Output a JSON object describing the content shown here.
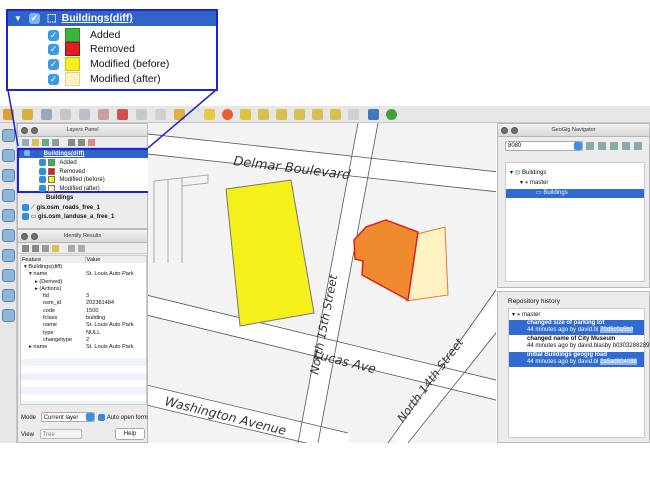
{
  "callout": {
    "layer_title": "Buildings(diff)",
    "legend": [
      {
        "label": "Added",
        "color": "#3cb43c"
      },
      {
        "label": "Removed",
        "color": "#e02020"
      },
      {
        "label": "Modified (before)",
        "color": "#f5f01a"
      },
      {
        "label": "Modified (after)",
        "color": "#fff2c2"
      }
    ]
  },
  "layers_panel": {
    "title": "Layers Panel",
    "layer_title": "Buildings(diff)",
    "legend": [
      {
        "label": "Added",
        "color": "#3cb43c"
      },
      {
        "label": "Removed",
        "color": "#e02020"
      },
      {
        "label": "Modified (before)",
        "color": "#f5f01a"
      },
      {
        "label": "Modified (after)",
        "color": "#fff2c2"
      }
    ],
    "layers": [
      "Buildings",
      "gis.osm_roads_free_1",
      "gis.osm_landuse_a_free_1"
    ]
  },
  "identify_panel": {
    "title": "Identify Results",
    "headers": [
      "Feature",
      "Value"
    ],
    "rows": [
      {
        "feature": "Buildings(diff)",
        "value": ""
      },
      {
        "feature": "name",
        "value": "St. Louis Auto Park"
      },
      {
        "feature": "(Derived)",
        "value": ""
      },
      {
        "feature": "(Actions)",
        "value": ""
      },
      {
        "feature": "fid",
        "value": "3"
      },
      {
        "feature": "osm_id",
        "value": "202381484"
      },
      {
        "feature": "code",
        "value": "1500"
      },
      {
        "feature": "fclass",
        "value": "building"
      },
      {
        "feature": "name",
        "value": "St. Louis Auto Park"
      },
      {
        "feature": "type",
        "value": "NULL"
      },
      {
        "feature": "changetype",
        "value": "2"
      },
      {
        "feature": "name",
        "value": "St. Louis Auto Park"
      }
    ],
    "mode_label": "Mode",
    "mode_value": "Current layer",
    "auto_open_label": "Auto open form",
    "view_label": "View",
    "view_value": "Tree",
    "help_label": "Help"
  },
  "map": {
    "streets": [
      "Delmar Boulevard",
      "North 15th Street",
      "Lucas Ave",
      "North 14th Street",
      "Washington Avenue"
    ]
  },
  "navigator": {
    "title": "GeoGig Navigator",
    "server_value": "8080",
    "tree": [
      "Buildings",
      "master",
      "Buildings"
    ]
  },
  "history": {
    "title": "Repository history",
    "branch": "master",
    "commits": [
      {
        "title": "changed size of parking lot",
        "meta": "44 minutes ago by david.bl",
        "hash": "70d5c0a5b0"
      },
      {
        "title": "changed name of City Museum",
        "meta": "44 minutes ago by david.blasby",
        "hash": "b0303288289"
      },
      {
        "title": "initial Buildings geogig load",
        "meta": "44 minutes ago by david.bl",
        "hash": "2a5ad804088"
      }
    ]
  }
}
